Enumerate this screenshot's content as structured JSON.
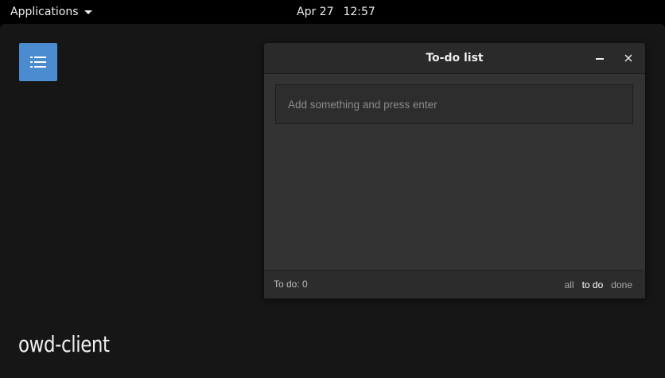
{
  "topbar": {
    "applications_label": "Applications",
    "clock": {
      "date": "Apr 27",
      "time": "12:57"
    }
  },
  "desktop": {
    "launcher_icon": "list-icon",
    "launcher_color": "#4a8ccf",
    "app_label": "owd-client"
  },
  "todo_window": {
    "title": "To-do list",
    "input": {
      "placeholder": "Add something and press enter",
      "value": ""
    },
    "footer": {
      "count_text": "To do: 0",
      "filters": [
        {
          "label": "all",
          "active": false
        },
        {
          "label": "to do",
          "active": true
        },
        {
          "label": "done",
          "active": false
        }
      ]
    }
  }
}
